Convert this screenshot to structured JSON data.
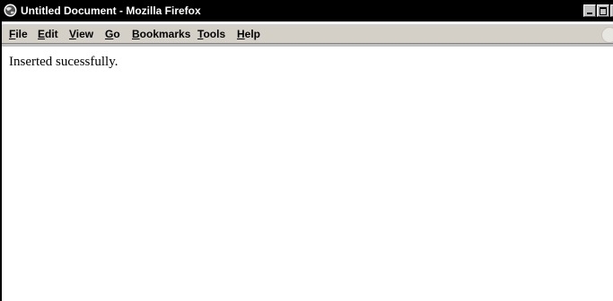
{
  "window": {
    "title": "Untitled Document - Mozilla Firefox",
    "icon": "firefox-globe-icon",
    "controls": [
      "minimize-icon",
      "maximize-icon",
      "close-icon"
    ]
  },
  "menubar": {
    "items": [
      {
        "label": "File"
      },
      {
        "label": "Edit"
      },
      {
        "label": "View"
      },
      {
        "label": "Go"
      },
      {
        "label": "Bookmarks"
      },
      {
        "label": "Tools"
      },
      {
        "label": "Help"
      }
    ],
    "throbber_icon": "throbber-icon"
  },
  "content": {
    "message": "Inserted sucessfully."
  },
  "colors": {
    "titlebar": "#000000",
    "title_text": "#ffffff",
    "menubar": "#d4d0c8",
    "page_bg": "#ffffff"
  }
}
